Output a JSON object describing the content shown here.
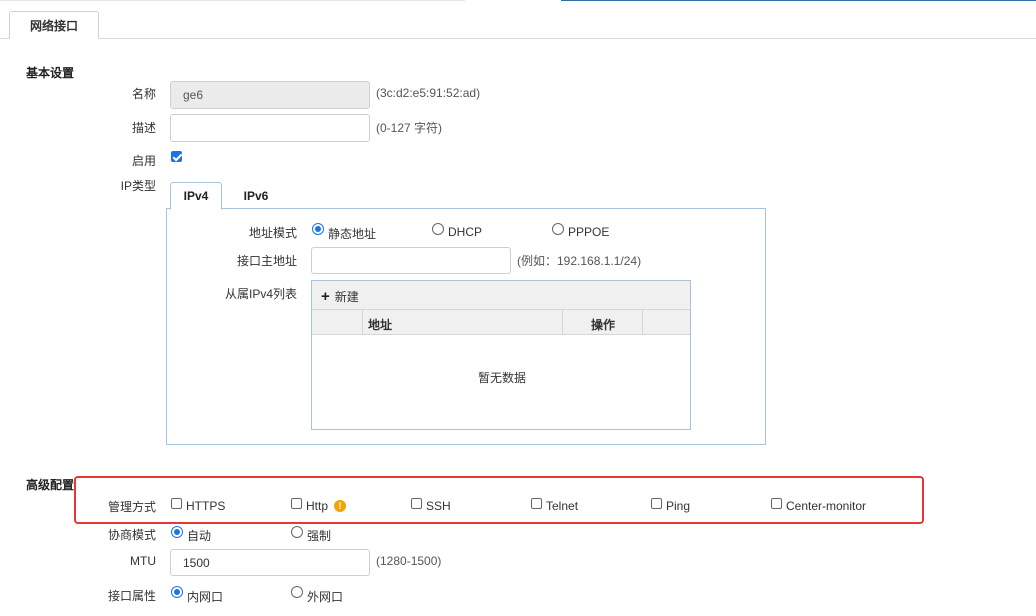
{
  "tab": {
    "label": "网络接口"
  },
  "basic": {
    "title": "基本设置",
    "name": {
      "label": "名称",
      "value": "ge6",
      "hint": "(3c:d2:e5:91:52:ad)"
    },
    "description": {
      "label": "描述",
      "value": "",
      "hint": "(0-127 字符)"
    },
    "enable": {
      "label": "启用",
      "checked": true
    },
    "ip_type": {
      "label": "IP类型",
      "tabs": [
        "IPv4",
        "IPv6"
      ],
      "address_mode": {
        "label": "地址模式",
        "options": [
          "静态地址",
          "DHCP",
          "PPPOE"
        ],
        "selected": "静态地址"
      },
      "primary_address": {
        "label": "接口主地址",
        "value": "",
        "hint": "(例如：192.168.1.1/24)"
      },
      "secondary_list": {
        "label": "从属IPv4列表",
        "add_label": "新建",
        "columns": [
          "地址",
          "操作"
        ],
        "empty_text": "暂无数据"
      }
    }
  },
  "advanced": {
    "title": "高级配置",
    "management": {
      "label": "管理方式",
      "options": [
        "HTTPS",
        "Http",
        "SSH",
        "Telnet",
        "Ping",
        "Center-monitor"
      ]
    },
    "negotiation": {
      "label": "协商模式",
      "options": [
        "自动",
        "强制"
      ],
      "selected": "自动"
    },
    "mtu": {
      "label": "MTU",
      "value": "1500",
      "hint": "(1280-1500)"
    },
    "interface_attr": {
      "label": "接口属性",
      "options": [
        "内网口",
        "外网口"
      ],
      "selected": "内网口"
    }
  },
  "colors": {
    "accent": "#1a73e8",
    "highlight": "#e53935",
    "warning": "#f0a500",
    "border": "#a8c4dc"
  }
}
